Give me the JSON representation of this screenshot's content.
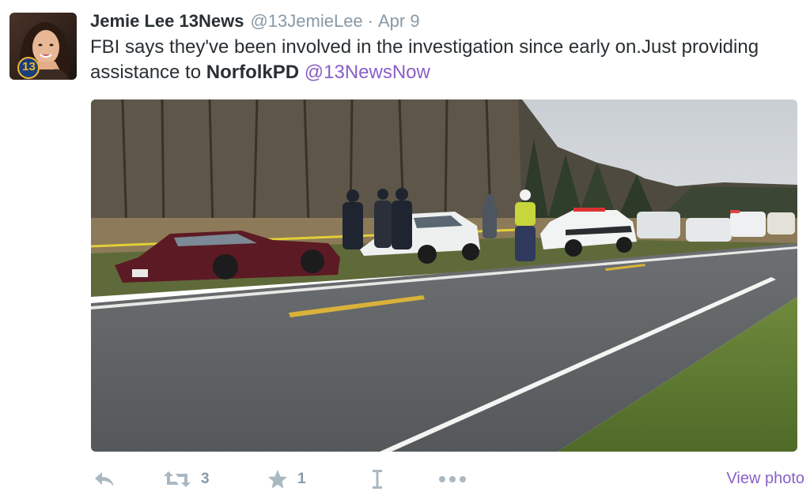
{
  "tweet": {
    "author": {
      "name": "Jemie Lee 13News",
      "handle": "@13JemieLee",
      "separator": "·",
      "date": "Apr 9",
      "avatar_badge": "13"
    },
    "text": {
      "part1": "FBI says they've been involved in the investigation since early on.Just providing assistance to ",
      "mention1": "NorfolkPD",
      "space": " ",
      "mention2": "@13NewsNow"
    },
    "actions": {
      "reply_icon": "reply-icon",
      "retweet_icon": "retweet-icon",
      "retweet_count": "3",
      "favorite_icon": "star-icon",
      "favorite_count": "1",
      "text_icon": "text-cursor-icon",
      "more_icon": "more-dots-icon",
      "view_photo": "View photo"
    }
  },
  "colors": {
    "link": "#8a5fc7",
    "muted": "#8899a6",
    "icon": "#aab8c2",
    "text": "#292f33"
  }
}
